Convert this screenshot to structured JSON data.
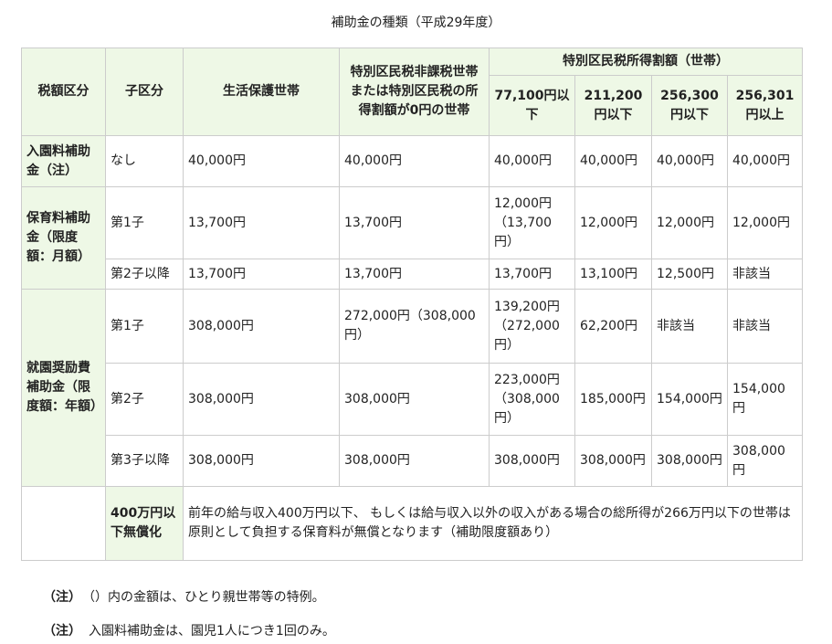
{
  "caption": "補助金の種類（平成29年度）",
  "headers": {
    "tax_class": "税額区分",
    "child_class": "子区分",
    "welfare": "生活保護世帯",
    "nontax": "特別区民税非課税世帯または特別区民税の所得割額が0円の世帯",
    "income_group": "特別区民税所得割額（世帯）",
    "b1": "77,100円以下",
    "b2": "211,200円以下",
    "b3": "256,300円以下",
    "b4": "256,301円以上"
  },
  "rows": {
    "entry": {
      "label": "入園料補助金（注）",
      "child": "なし",
      "c": [
        "40,000円",
        "40,000円",
        "40,000円",
        "40,000円",
        "40,000円",
        "40,000円"
      ]
    },
    "hoiku": {
      "label": "保育料補助金（限度額：月額）",
      "first": {
        "child": "第1子",
        "c": [
          "13,700円",
          "13,700円",
          "12,000円（13,700円）",
          "12,000円",
          "12,000円",
          "12,000円"
        ]
      },
      "second": {
        "child": "第2子以降",
        "c": [
          "13,700円",
          "13,700円",
          "13,700円",
          "13,100円",
          "12,500円",
          "非該当"
        ]
      }
    },
    "shuen": {
      "label": "就園奨励費補助金（限度額：年額）",
      "first": {
        "child": "第1子",
        "c": [
          "308,000円",
          "272,000円（308,000円）",
          "139,200円（272,000円）",
          "62,200円",
          "非該当",
          "非該当"
        ]
      },
      "second": {
        "child": "第2子",
        "c": [
          "308,000円",
          "308,000円",
          "223,000円（308,000円）",
          "185,000円",
          "154,000円",
          "154,000円"
        ]
      },
      "third": {
        "child": "第3子以降",
        "c": [
          "308,000円",
          "308,000円",
          "308,000円",
          "308,000円",
          "308,000円",
          "308,000円"
        ]
      },
      "free": {
        "label": "400万円以下無償化",
        "text": "前年の給与収入400万円以下、 もしくは給与収入以外の収入がある場合の総所得が266万円以下の世帯は原則として負担する保育料が無償となります（補助限度額あり）"
      }
    }
  },
  "notes": [
    {
      "mark": "（注）",
      "text": "（）内の金額は、ひとり親世帯等の特例。"
    },
    {
      "mark": "（注）",
      "text": "入園料補助金は、園児1人につき1回のみ。"
    }
  ],
  "colors": {
    "header_bg": "#eef8e6",
    "border": "#cccccc"
  }
}
